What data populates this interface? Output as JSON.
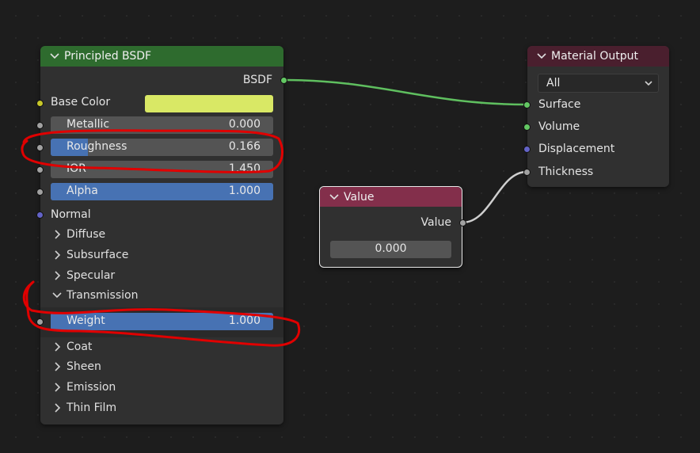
{
  "colors": {
    "bsdf_header": "#2e6b2e",
    "output_header": "#4a1f2e",
    "value_header": "#832f4b",
    "socket_yellow": "#c7c729",
    "socket_gray": "#a1a1a1",
    "socket_purple": "#6363c7",
    "socket_green": "#63c763",
    "field_blue": "#4772b3",
    "base_color_swatch": "#d9e865",
    "annotation_red": "#e00000"
  },
  "bsdf_node": {
    "title": "Principled BSDF",
    "output_label": "BSDF",
    "base_color_label": "Base Color",
    "metallic": {
      "label": "Metallic",
      "value": "0.000",
      "fraction": 0.0
    },
    "roughness": {
      "label": "Roughness",
      "value": "0.166",
      "fraction": 0.166
    },
    "ior": {
      "label": "IOR",
      "value": "1.450"
    },
    "alpha": {
      "label": "Alpha",
      "value": "1.000",
      "fraction": 1.0
    },
    "normal_label": "Normal",
    "panels": {
      "diffuse": "Diffuse",
      "subsurface": "Subsurface",
      "specular": "Specular",
      "transmission": "Transmission",
      "coat": "Coat",
      "sheen": "Sheen",
      "emission": "Emission",
      "thin_film": "Thin Film"
    },
    "weight": {
      "label": "Weight",
      "value": "1.000",
      "fraction": 1.0
    }
  },
  "output_node": {
    "title": "Material Output",
    "target": "All",
    "inputs": {
      "surface": "Surface",
      "volume": "Volume",
      "displacement": "Displacement",
      "thickness": "Thickness"
    }
  },
  "value_node": {
    "title": "Value",
    "output_label": "Value",
    "value": "0.000"
  }
}
